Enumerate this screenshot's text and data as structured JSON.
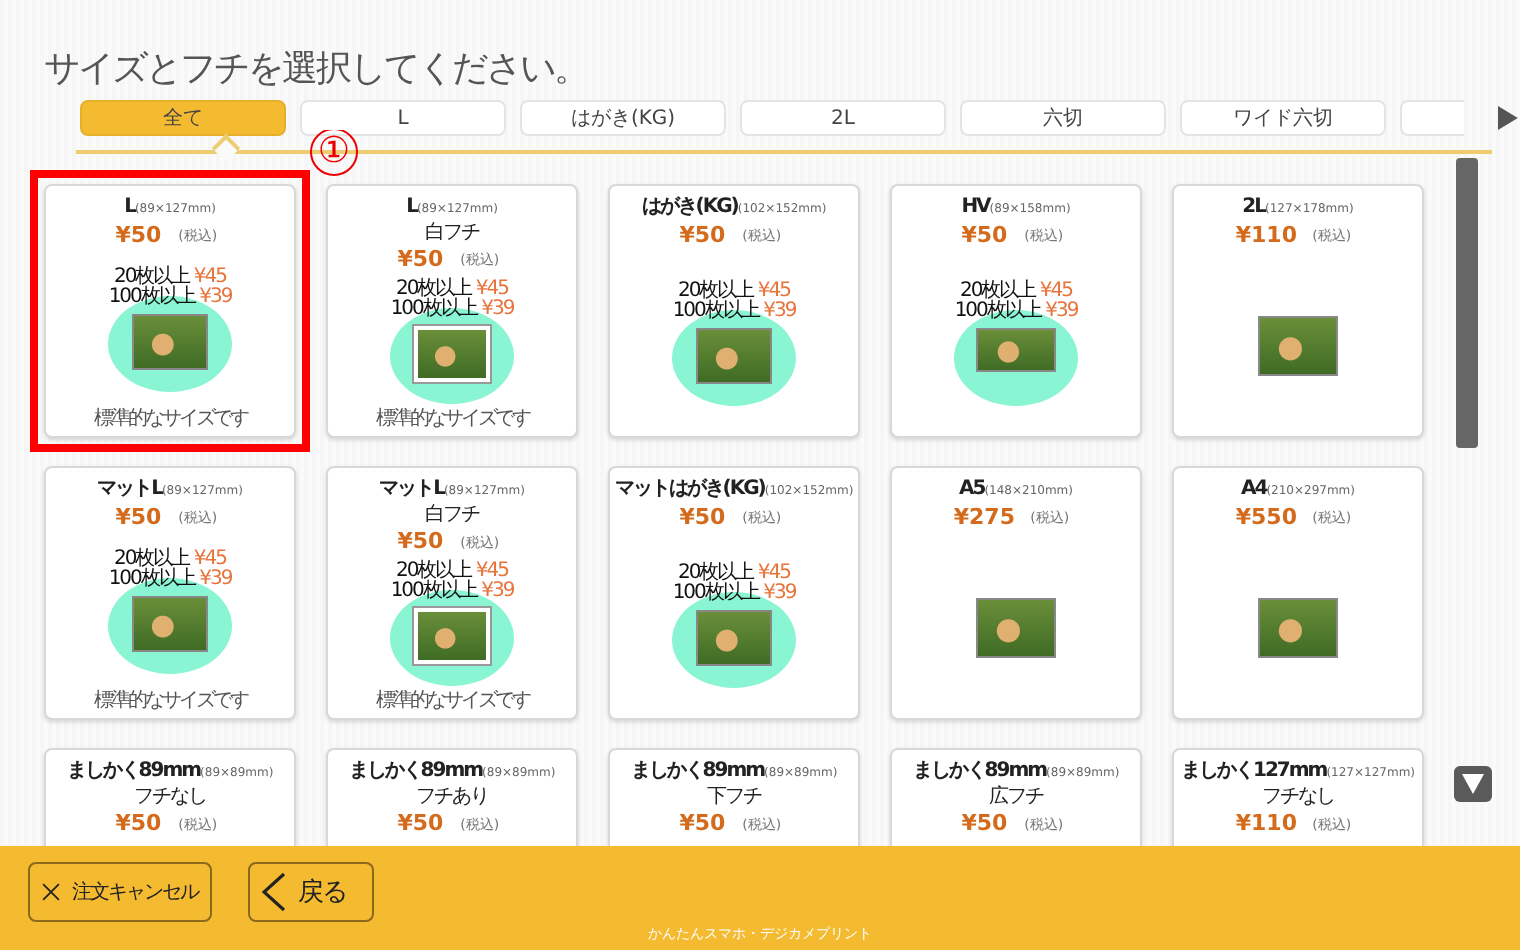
{
  "title": "サイズとフチを選択してください。",
  "tabs": [
    {
      "label": "全て",
      "selected": true
    },
    {
      "label": "L",
      "selected": false
    },
    {
      "label": "はがき(KG)",
      "selected": false
    },
    {
      "label": "2L",
      "selected": false
    },
    {
      "label": "六切",
      "selected": false
    },
    {
      "label": "ワイド六切",
      "selected": false
    }
  ],
  "annotation": {
    "marker": "①"
  },
  "cards": [
    {
      "name": "L",
      "size": "(89×127mm)",
      "price": "¥50",
      "tax": "(税込)",
      "highlighted": true,
      "bulk": [
        {
          "label": "20枚以上",
          "price": "¥45"
        },
        {
          "label": "100枚以上",
          "price": "¥39"
        }
      ],
      "photo": {
        "kind": "l",
        "bordered": false
      },
      "note": "標準的なサイズです"
    },
    {
      "name": "L",
      "size": "(89×127mm)",
      "sub": "白フチ",
      "price": "¥50",
      "tax": "(税込)",
      "highlighted": false,
      "bulk": [
        {
          "label": "20枚以上",
          "price": "¥45"
        },
        {
          "label": "100枚以上",
          "price": "¥39"
        }
      ],
      "photo": {
        "kind": "l",
        "bordered": true
      },
      "note": "標準的なサイズです"
    },
    {
      "name": "はがき(KG)",
      "size": "(102×152mm)",
      "price": "¥50",
      "tax": "(税込)",
      "highlighted": false,
      "bulk": [
        {
          "label": "20枚以上",
          "price": "¥45"
        },
        {
          "label": "100枚以上",
          "price": "¥39"
        }
      ],
      "photo": {
        "kind": "l",
        "bordered": false
      }
    },
    {
      "name": "HV",
      "size": "(89×158mm)",
      "price": "¥50",
      "tax": "(税込)",
      "highlighted": false,
      "bulk": [
        {
          "label": "20枚以上",
          "price": "¥45"
        },
        {
          "label": "100枚以上",
          "price": "¥39"
        }
      ],
      "photo": {
        "kind": "wide",
        "bordered": false
      }
    },
    {
      "name": "2L",
      "size": "(127×178mm)",
      "price": "¥110",
      "tax": "(税込)",
      "highlighted": false,
      "photo": {
        "kind": "medium",
        "bordered": false
      }
    },
    {
      "name": "マットL",
      "size": "(89×127mm)",
      "price": "¥50",
      "tax": "(税込)",
      "highlighted": false,
      "bulk": [
        {
          "label": "20枚以上",
          "price": "¥45"
        },
        {
          "label": "100枚以上",
          "price": "¥39"
        }
      ],
      "photo": {
        "kind": "l",
        "bordered": false
      },
      "note": "標準的なサイズです"
    },
    {
      "name": "マットL",
      "size": "(89×127mm)",
      "sub": "白フチ",
      "price": "¥50",
      "tax": "(税込)",
      "highlighted": false,
      "bulk": [
        {
          "label": "20枚以上",
          "price": "¥45"
        },
        {
          "label": "100枚以上",
          "price": "¥39"
        }
      ],
      "photo": {
        "kind": "l",
        "bordered": true
      },
      "note": "標準的なサイズです"
    },
    {
      "name": "マットはがき(KG)",
      "size": "(102×152mm)",
      "price": "¥50",
      "tax": "(税込)",
      "highlighted": false,
      "bulk": [
        {
          "label": "20枚以上",
          "price": "¥45"
        },
        {
          "label": "100枚以上",
          "price": "¥39"
        }
      ],
      "photo": {
        "kind": "l",
        "bordered": false
      }
    },
    {
      "name": "A5",
      "size": "(148×210mm)",
      "price": "¥275",
      "tax": "(税込)",
      "highlighted": false,
      "photo": {
        "kind": "medium",
        "bordered": false
      }
    },
    {
      "name": "A4",
      "size": "(210×297mm)",
      "price": "¥550",
      "tax": "(税込)",
      "highlighted": false,
      "photo": {
        "kind": "large",
        "bordered": false
      }
    },
    {
      "name": "ましかく89mm",
      "size": "(89×89mm)",
      "sub": "フチなし",
      "price": "¥50",
      "tax": "(税込)",
      "highlighted": false
    },
    {
      "name": "ましかく89mm",
      "size": "(89×89mm)",
      "sub": "フチあり",
      "price": "¥50",
      "tax": "(税込)",
      "highlighted": false
    },
    {
      "name": "ましかく89mm",
      "size": "(89×89mm)",
      "sub": "下フチ",
      "price": "¥50",
      "tax": "(税込)",
      "highlighted": false
    },
    {
      "name": "ましかく89mm",
      "size": "(89×89mm)",
      "sub": "広フチ",
      "price": "¥50",
      "tax": "(税込)",
      "highlighted": false
    },
    {
      "name": "ましかく127mm",
      "size": "(127×127mm)",
      "sub": "フチなし",
      "price": "¥110",
      "tax": "(税込)",
      "highlighted": false
    }
  ],
  "footer": {
    "buttons": [
      {
        "kind": "cancel",
        "label": "注文キャンセル"
      },
      {
        "kind": "back",
        "label": "戻る"
      }
    ],
    "caption": "かんたんスマホ・デジカメプリント"
  }
}
